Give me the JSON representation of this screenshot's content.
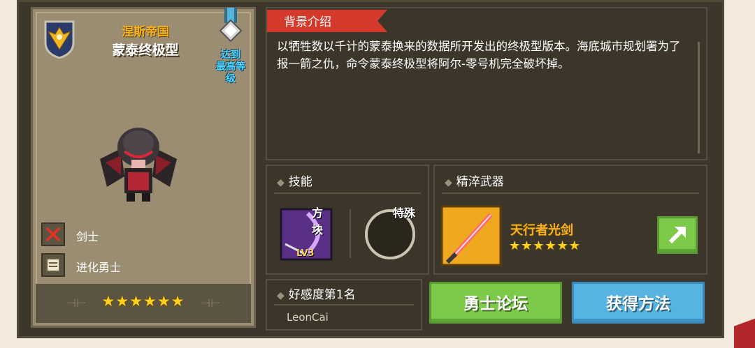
{
  "character": {
    "faction": "涅斯帝国",
    "name": "蒙泰终极型",
    "max_level_badge": [
      "达到",
      "最高等",
      "级"
    ],
    "class": "剑士",
    "evolution": "进化勇士",
    "stars": "★★★★★★",
    "star_count": 6
  },
  "background": {
    "title": "背景介绍",
    "text": "以牺牲数以千计的蒙泰换来的数据所开发出的终极型版本。海底城市规划署为了报一箭之仇，命令蒙泰终极型将阿尔-零号机完全破坏掉。"
  },
  "skills": {
    "title": "技能",
    "skill1_label": "方块",
    "skill1_level": "LV3",
    "skill2_label": "特殊"
  },
  "weapon": {
    "title": "精淬武器",
    "name": "天行者光剑",
    "stars": "★★★★★★",
    "star_count": 6
  },
  "affinity": {
    "title": "好感度第1名",
    "user": "LeonCai"
  },
  "buttons": {
    "forum": "勇士论坛",
    "obtain": "获得方法"
  },
  "colors": {
    "accent_red": "#d33a2c",
    "gold": "#f5b21d",
    "green_button": "#7dc94a",
    "blue_button": "#56b3e2"
  }
}
